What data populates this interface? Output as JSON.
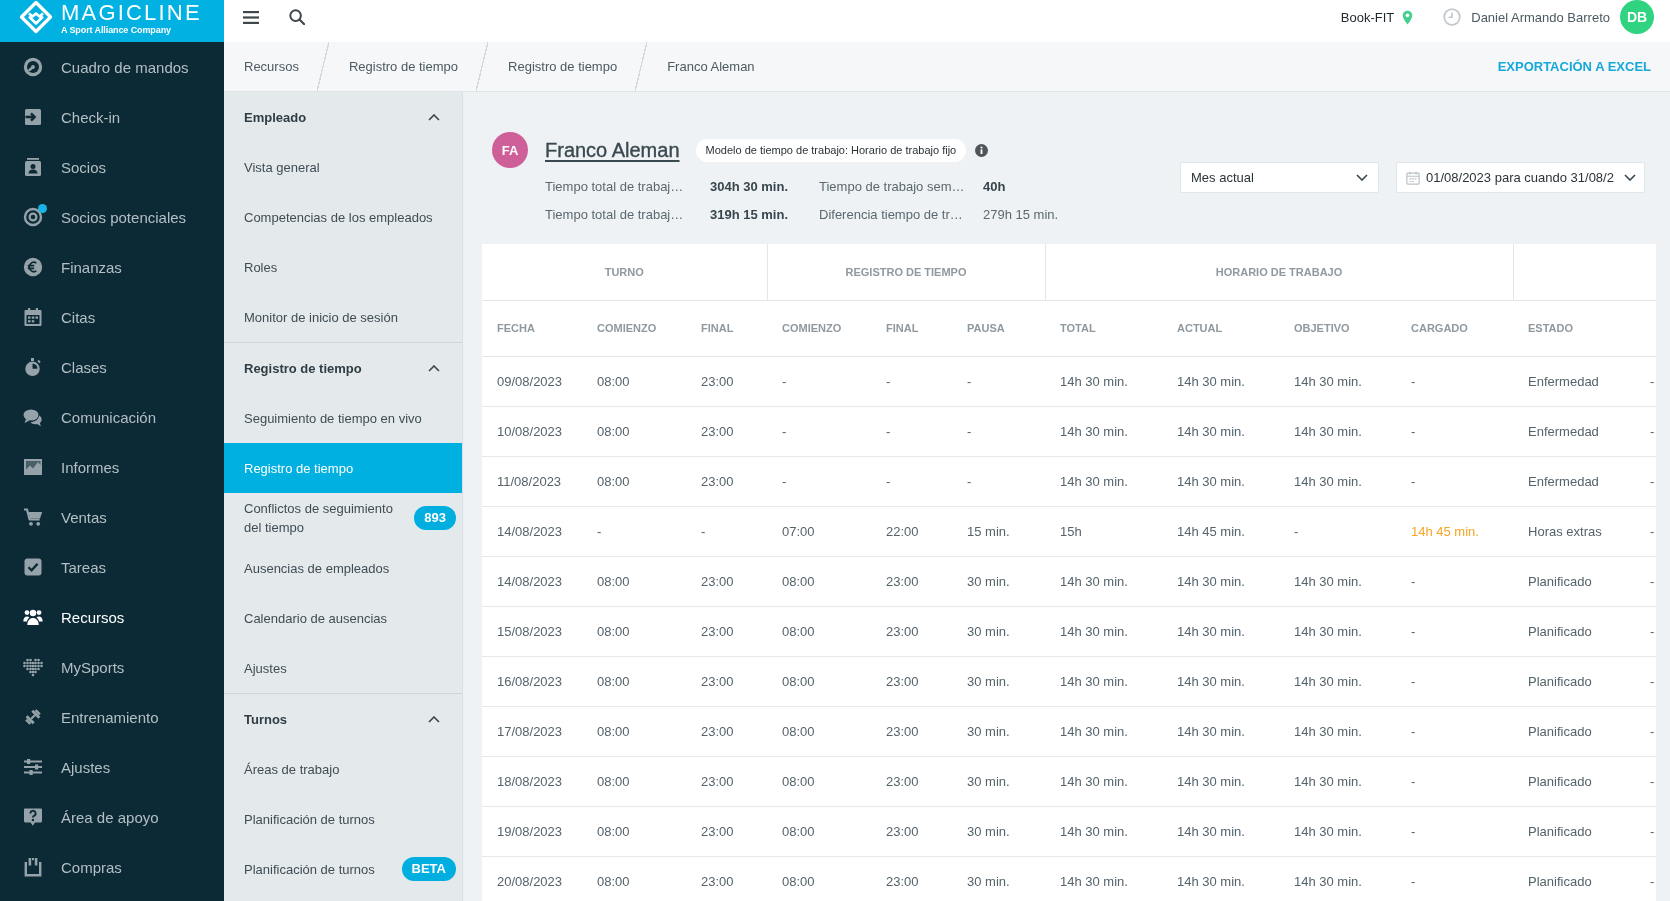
{
  "brand": {
    "name": "MAGICLINE",
    "tagline": "A Sport Alliance Company"
  },
  "sidebar": {
    "items": [
      {
        "label": "Cuadro de mandos",
        "selected": false,
        "notification": false
      },
      {
        "label": "Check-in",
        "selected": false,
        "notification": false
      },
      {
        "label": "Socios",
        "selected": false,
        "notification": false
      },
      {
        "label": "Socios potenciales",
        "selected": false,
        "notification": true
      },
      {
        "label": "Finanzas",
        "selected": false,
        "notification": false
      },
      {
        "label": "Citas",
        "selected": false,
        "notification": false
      },
      {
        "label": "Clases",
        "selected": false,
        "notification": false
      },
      {
        "label": "Comunicación",
        "selected": false,
        "notification": false
      },
      {
        "label": "Informes",
        "selected": false,
        "notification": false
      },
      {
        "label": "Ventas",
        "selected": false,
        "notification": false
      },
      {
        "label": "Tareas",
        "selected": false,
        "notification": false
      },
      {
        "label": "Recursos",
        "selected": true,
        "notification": false
      },
      {
        "label": "MySports",
        "selected": false,
        "notification": false
      },
      {
        "label": "Entrenamiento",
        "selected": false,
        "notification": false
      },
      {
        "label": "Ajustes",
        "selected": false,
        "notification": false
      },
      {
        "label": "Área de apoyo",
        "selected": false,
        "notification": false
      },
      {
        "label": "Compras",
        "selected": false,
        "notification": false
      }
    ]
  },
  "topbar": {
    "studio": "Book-FIT",
    "user_name": "Daniel Armando Barreto",
    "user_initials": "DB"
  },
  "breadcrumbs": [
    "Recursos",
    "Registro de tiempo",
    "Registro de tiempo",
    "Franco Aleman"
  ],
  "export_link": "EXPORTACIÓN A EXCEL",
  "section_nav": {
    "groups": [
      {
        "title": "Empleado",
        "expanded": true,
        "items": [
          {
            "label": "Vista general",
            "selected": false
          },
          {
            "label": "Competencias de los empleados",
            "selected": false
          },
          {
            "label": "Roles",
            "selected": false
          },
          {
            "label": "Monitor de inicio de sesión",
            "selected": false
          }
        ]
      },
      {
        "title": "Registro de tiempo",
        "expanded": true,
        "items": [
          {
            "label": "Seguimiento de tiempo en vivo",
            "selected": false
          },
          {
            "label": "Registro de tiempo",
            "selected": true
          },
          {
            "label": "Conflictos de seguimiento del tiempo",
            "selected": false,
            "badge": "893"
          },
          {
            "label": "Ausencias de empleados",
            "selected": false
          },
          {
            "label": "Calendario de ausencias",
            "selected": false
          },
          {
            "label": "Ajustes",
            "selected": false
          }
        ]
      },
      {
        "title": "Turnos",
        "expanded": true,
        "items": [
          {
            "label": "Áreas de trabajo",
            "selected": false
          },
          {
            "label": "Planificación de turnos",
            "selected": false
          },
          {
            "label": "Planificación de turnos",
            "selected": false,
            "badge": "BETA"
          }
        ]
      }
    ]
  },
  "employee": {
    "initials": "FA",
    "name": "Franco Aleman",
    "work_model": "Modelo de tiempo de trabajo: Horario de trabajo fijo",
    "stats": [
      {
        "label": "Tiempo total de trabaj…",
        "value": "304h 30 min.",
        "emphasis": true
      },
      {
        "label": "Tiempo de trabajo sem…",
        "value": "40h",
        "emphasis": true
      },
      {
        "label": "Tiempo total de trabaj…",
        "value": "319h 15 min.",
        "emphasis": true
      },
      {
        "label": "Diferencia tiempo de tr…",
        "value": "279h 15 min.",
        "emphasis": false
      }
    ]
  },
  "filters": {
    "period": "Mes actual",
    "date_range": "01/08/2023 para cuando 31/08/2"
  },
  "table": {
    "column_groups": [
      {
        "label": "TURNO",
        "columns": [
          "FECHA",
          "COMIENZO",
          "FINAL"
        ]
      },
      {
        "label": "REGISTRO DE TIEMPO",
        "columns": [
          "COMIENZO",
          "FINAL",
          "PAUSA"
        ]
      },
      {
        "label": "HORARIO DE TRABAJO",
        "columns": [
          "TOTAL",
          "ACTUAL",
          "OBJETIVO",
          "CARGADO"
        ]
      },
      {
        "columns": [
          "ESTADO"
        ]
      }
    ],
    "rows": [
      {
        "cells": [
          "09/08/2023",
          "08:00",
          "23:00",
          "-",
          "-",
          "-",
          "14h 30 min.",
          "14h 30 min.",
          "14h 30 min.",
          "-",
          "Enfermedad",
          "-"
        ],
        "charged_warning": false
      },
      {
        "cells": [
          "10/08/2023",
          "08:00",
          "23:00",
          "-",
          "-",
          "-",
          "14h 30 min.",
          "14h 30 min.",
          "14h 30 min.",
          "-",
          "Enfermedad",
          "-"
        ],
        "charged_warning": false
      },
      {
        "cells": [
          "11/08/2023",
          "08:00",
          "23:00",
          "-",
          "-",
          "-",
          "14h 30 min.",
          "14h 30 min.",
          "14h 30 min.",
          "-",
          "Enfermedad",
          "-"
        ],
        "charged_warning": false
      },
      {
        "cells": [
          "14/08/2023",
          "-",
          "-",
          "07:00",
          "22:00",
          "15 min.",
          "15h",
          "14h 45 min.",
          "-",
          "14h 45 min.",
          "Horas extras",
          "-"
        ],
        "charged_warning": true
      },
      {
        "cells": [
          "14/08/2023",
          "08:00",
          "23:00",
          "08:00",
          "23:00",
          "30 min.",
          "14h 30 min.",
          "14h 30 min.",
          "14h 30 min.",
          "-",
          "Planificado",
          "-"
        ],
        "charged_warning": false
      },
      {
        "cells": [
          "15/08/2023",
          "08:00",
          "23:00",
          "08:00",
          "23:00",
          "30 min.",
          "14h 30 min.",
          "14h 30 min.",
          "14h 30 min.",
          "-",
          "Planificado",
          "-"
        ],
        "charged_warning": false
      },
      {
        "cells": [
          "16/08/2023",
          "08:00",
          "23:00",
          "08:00",
          "23:00",
          "30 min.",
          "14h 30 min.",
          "14h 30 min.",
          "14h 30 min.",
          "-",
          "Planificado",
          "-"
        ],
        "charged_warning": false
      },
      {
        "cells": [
          "17/08/2023",
          "08:00",
          "23:00",
          "08:00",
          "23:00",
          "30 min.",
          "14h 30 min.",
          "14h 30 min.",
          "14h 30 min.",
          "-",
          "Planificado",
          "-"
        ],
        "charged_warning": false
      },
      {
        "cells": [
          "18/08/2023",
          "08:00",
          "23:00",
          "08:00",
          "23:00",
          "30 min.",
          "14h 30 min.",
          "14h 30 min.",
          "14h 30 min.",
          "-",
          "Planificado",
          "-"
        ],
        "charged_warning": false
      },
      {
        "cells": [
          "19/08/2023",
          "08:00",
          "23:00",
          "08:00",
          "23:00",
          "30 min.",
          "14h 30 min.",
          "14h 30 min.",
          "14h 30 min.",
          "-",
          "Planificado",
          "-"
        ],
        "charged_warning": false
      },
      {
        "cells": [
          "20/08/2023",
          "08:00",
          "23:00",
          "08:00",
          "23:00",
          "30 min.",
          "14h 30 min.",
          "14h 30 min.",
          "14h 30 min.",
          "-",
          "Planificado",
          "-"
        ],
        "charged_warning": false
      }
    ]
  }
}
